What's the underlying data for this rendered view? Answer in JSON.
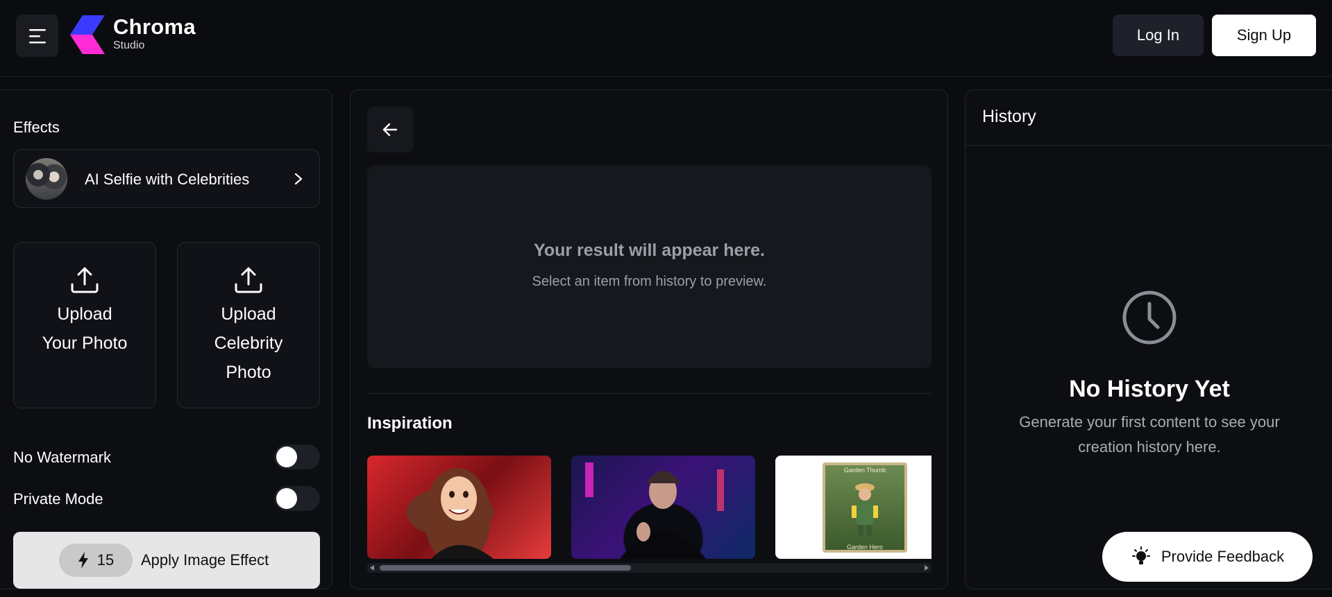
{
  "header": {
    "brand_name": "Chroma",
    "brand_sub": "Studio",
    "login_label": "Log In",
    "signup_label": "Sign Up"
  },
  "left": {
    "effects_title": "Effects",
    "effect_label": "AI Selfie with Celebrities",
    "upload_your_photo": "Upload Your Photo",
    "upload_celebrity_photo": "Upload Celebrity Photo",
    "toggles": [
      {
        "label": "No Watermark",
        "on": false
      },
      {
        "label": "Private Mode",
        "on": false
      }
    ],
    "apply_count": "15",
    "apply_label": "Apply Image Effect"
  },
  "middle": {
    "result_title": "Your result will appear here.",
    "result_sub": "Select an item from history to preview.",
    "inspiration_title": "Inspiration",
    "thumb_3_top": "Garden Thumb",
    "thumb_3_bottom": "Garden Hero"
  },
  "right": {
    "history_title": "History",
    "empty_title": "No History Yet",
    "empty_sub": "Generate your first content to see your creation history here."
  },
  "feedback_label": "Provide Feedback",
  "colors": {
    "background": "#0b0c0f",
    "panel": "#0d0e12",
    "logo_blue": "#3b3bff",
    "logo_magenta": "#ff2bd6"
  }
}
